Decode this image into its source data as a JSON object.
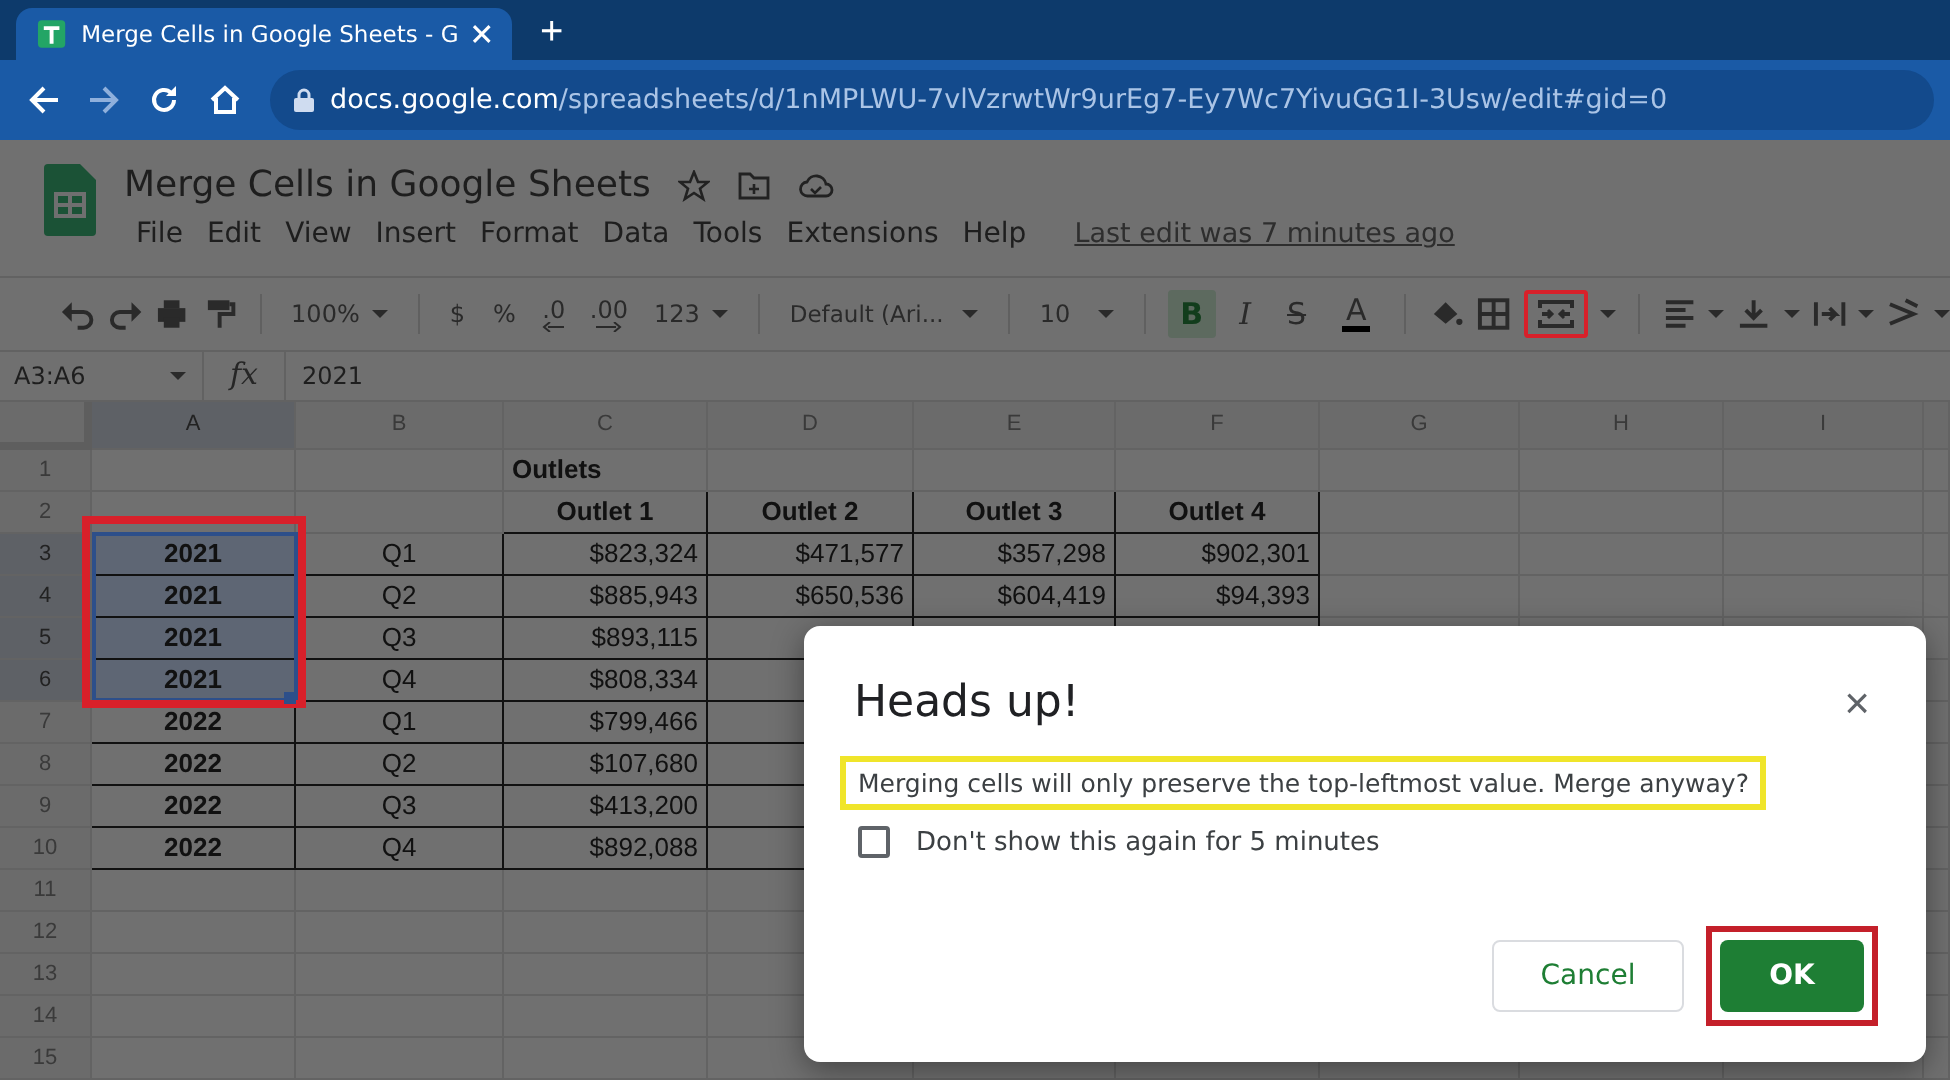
{
  "browser": {
    "tab": {
      "title": "Merge Cells in Google Sheets - G",
      "selected": true
    },
    "new_tab": "+",
    "url": "docs.google.com/spreadsheets/d/1nMPLWU-7vlVzrwtWr9urEg7-Ey7Wc7YivuGG1I-3Usw/edit#gid=0"
  },
  "document": {
    "title": "Merge Cells in Google Sheets",
    "menu": [
      "File",
      "Edit",
      "View",
      "Insert",
      "Format",
      "Data",
      "Tools",
      "Extensions",
      "Help"
    ],
    "last_edit": "Last edit was 7 minutes ago"
  },
  "toolbar": {
    "zoom": "100%",
    "currency": "$",
    "percent": "%",
    "decimal_less": ".0",
    "decimal_more": ".00",
    "number_format": "123",
    "font": "Default (Ari...",
    "font_size": "10",
    "bold": {
      "label": "B",
      "active": true
    },
    "italic": "I",
    "strikethrough": "S",
    "text_color": "A",
    "merge_annotated": true
  },
  "formula_bar": {
    "name_box": "A3:A6",
    "fx": "fx",
    "formula": "2021"
  },
  "sheet": {
    "selection_annotated": true,
    "columns": [
      {
        "label": "A",
        "selected": true
      },
      {
        "label": "B",
        "selected": false
      },
      {
        "label": "C",
        "selected": false
      },
      {
        "label": "D",
        "selected": false
      },
      {
        "label": "E",
        "selected": false
      },
      {
        "label": "F",
        "selected": false
      },
      {
        "label": "G",
        "selected": false
      },
      {
        "label": "H",
        "selected": false
      },
      {
        "label": "I",
        "selected": false
      }
    ],
    "rows": [
      {
        "number": "1",
        "kind": "title",
        "selected": false,
        "cells": {
          "C": "Outlets"
        }
      },
      {
        "number": "2",
        "kind": "header",
        "selected": false,
        "cells": {
          "C": "Outlet 1",
          "D": "Outlet 2",
          "E": "Outlet 3",
          "F": "Outlet 4"
        }
      },
      {
        "number": "3",
        "kind": "data",
        "selected": true,
        "cells": {
          "A": "2021",
          "B": "Q1",
          "C": "$823,324",
          "D": "$471,577",
          "E": "$357,298",
          "F": "$902,301"
        }
      },
      {
        "number": "4",
        "kind": "data",
        "selected": true,
        "cells": {
          "A": "2021",
          "B": "Q2",
          "C": "$885,943",
          "D": "$650,536",
          "E": "$604,419",
          "F": "$94,393"
        }
      },
      {
        "number": "5",
        "kind": "data",
        "selected": true,
        "cells": {
          "A": "2021",
          "B": "Q3",
          "C": "$893,115"
        }
      },
      {
        "number": "6",
        "kind": "data",
        "selected": true,
        "cells": {
          "A": "2021",
          "B": "Q4",
          "C": "$808,334"
        }
      },
      {
        "number": "7",
        "kind": "data",
        "selected": false,
        "cells": {
          "A": "2022",
          "B": "Q1",
          "C": "$799,466"
        }
      },
      {
        "number": "8",
        "kind": "data",
        "selected": false,
        "cells": {
          "A": "2022",
          "B": "Q2",
          "C": "$107,680"
        }
      },
      {
        "number": "9",
        "kind": "data",
        "selected": false,
        "cells": {
          "A": "2022",
          "B": "Q3",
          "C": "$413,200"
        }
      },
      {
        "number": "10",
        "kind": "data",
        "selected": false,
        "cells": {
          "A": "2022",
          "B": "Q4",
          "C": "$892,088"
        }
      },
      {
        "number": "11",
        "kind": "empty",
        "selected": false
      },
      {
        "number": "12",
        "kind": "empty",
        "selected": false
      },
      {
        "number": "13",
        "kind": "empty",
        "selected": false
      },
      {
        "number": "14",
        "kind": "empty",
        "selected": false
      },
      {
        "number": "15",
        "kind": "empty",
        "selected": false
      }
    ]
  },
  "dialog": {
    "title": "Heads up!",
    "close": "×",
    "message": {
      "text": "Merging cells will only preserve the top-leftmost value. Merge anyway?",
      "annotated": true
    },
    "checkbox": {
      "label": "Don't show this again for 5 minutes",
      "checked": false
    },
    "buttons": [
      {
        "label": "Cancel",
        "kind": "secondary",
        "annotated": false
      },
      {
        "label": "OK",
        "kind": "primary",
        "annotated": true
      }
    ]
  }
}
